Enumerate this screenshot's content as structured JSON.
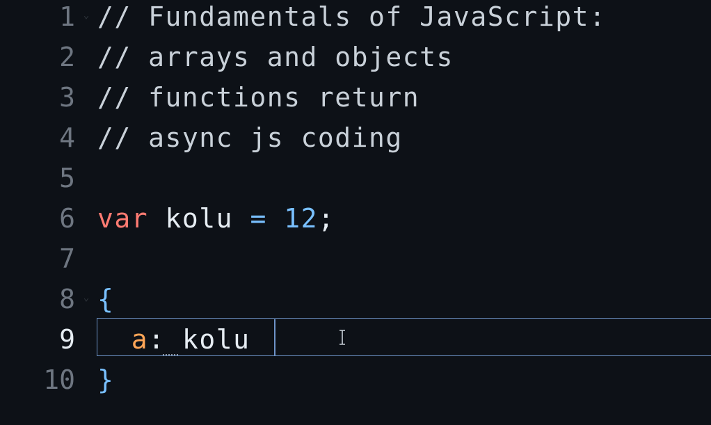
{
  "editor": {
    "lines": [
      {
        "num": "1",
        "text": "// Fundamentals of JavaScript:"
      },
      {
        "num": "2",
        "text": "// arrays and objects"
      },
      {
        "num": "3",
        "text": "// functions return"
      },
      {
        "num": "4",
        "text": "// async js coding"
      },
      {
        "num": "5",
        "text": ""
      },
      {
        "num": "6",
        "kw": "var",
        "ident": "kolu",
        "op": "=",
        "num_val": "12",
        "semi": ";"
      },
      {
        "num": "7",
        "text": ""
      },
      {
        "num": "8",
        "brace": "{"
      },
      {
        "num": "9",
        "prop": "a",
        "colon": ":",
        "ident": "kolu"
      },
      {
        "num": "10",
        "brace": "}"
      }
    ],
    "active_line": 9,
    "colors": {
      "background": "#0d1117",
      "keyword": "#ff7b72",
      "number": "#79c0ff",
      "property": "#ffa657",
      "active_border": "#6e94c8"
    },
    "icons": [
      "fold-chevron-icon",
      "text-cursor-ibeam-icon"
    ]
  }
}
